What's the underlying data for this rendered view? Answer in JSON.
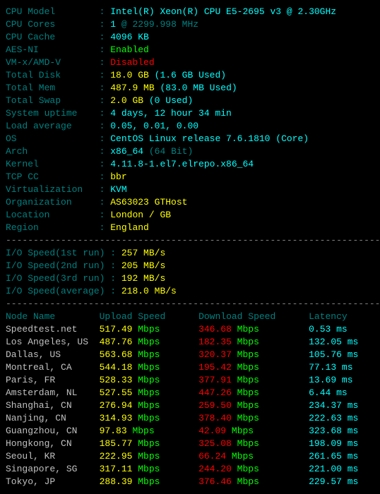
{
  "sysinfo": [
    {
      "label": "CPU Model",
      "value_main": "Intel(R) Xeon(R) CPU E5-2695 v3 @ 2.30GHz",
      "value_main_color": "aqua"
    },
    {
      "label": "CPU Cores",
      "value_main": "1",
      "value_main_color": "aqua",
      "value_sub": "@ 2299.998 MHz",
      "value_sub_color": "teal"
    },
    {
      "label": "CPU Cache",
      "value_main": "4096 KB",
      "value_main_color": "aqua"
    },
    {
      "label": "AES-NI",
      "value_main": "Enabled",
      "value_main_color": "green"
    },
    {
      "label": "VM-x/AMD-V",
      "value_main": "Disabled",
      "value_main_color": "red"
    },
    {
      "label": "Total Disk",
      "value_main": "18.0 GB",
      "value_main_color": "yellow",
      "value_sub": "(1.6 GB Used)",
      "value_sub_color": "aqua"
    },
    {
      "label": "Total Mem",
      "value_main": "487.9 MB",
      "value_main_color": "yellow",
      "value_sub": "(83.0 MB Used)",
      "value_sub_color": "aqua"
    },
    {
      "label": "Total Swap",
      "value_main": "2.0 GB",
      "value_main_color": "yellow",
      "value_sub": "(0 Used)",
      "value_sub_color": "aqua"
    },
    {
      "label": "System uptime",
      "value_main": "4 days, 12 hour 34 min",
      "value_main_color": "aqua"
    },
    {
      "label": "Load average",
      "value_main": "0.05, 0.01, 0.00",
      "value_main_color": "aqua"
    },
    {
      "label": "OS",
      "value_main": "CentOS Linux release 7.6.1810 (Core)",
      "value_main_color": "aqua"
    },
    {
      "label": "Arch",
      "value_main": "x86_64",
      "value_main_color": "aqua",
      "value_sub": "(64 Bit)",
      "value_sub_color": "teal"
    },
    {
      "label": "Kernel",
      "value_main": "4.11.8-1.el7.elrepo.x86_64",
      "value_main_color": "aqua"
    },
    {
      "label": "TCP CC",
      "value_main": "bbr",
      "value_main_color": "yellow"
    },
    {
      "label": "Virtualization",
      "value_main": "KVM",
      "value_main_color": "aqua"
    },
    {
      "label": "Organization",
      "value_main": "AS63023 GTHost",
      "value_main_color": "yellow"
    },
    {
      "label": "Location",
      "value_main": "London / GB",
      "value_main_color": "yellow"
    },
    {
      "label": "Region",
      "value_main": "England",
      "value_main_color": "yellow"
    }
  ],
  "divider": "----------------------------------------------------------------------",
  "io_label_width": 19,
  "io": [
    {
      "label": "I/O Speed(1st run)",
      "value": "257 MB/s"
    },
    {
      "label": "I/O Speed(2nd run)",
      "value": "205 MB/s"
    },
    {
      "label": "I/O Speed(3rd run)",
      "value": "192 MB/s"
    },
    {
      "label": "I/O Speed(average)",
      "value": "218.0 MB/s"
    }
  ],
  "net_header": {
    "c1": "Node Name",
    "c2": "Upload Speed",
    "c3": "Download Speed",
    "c4": "Latency"
  },
  "net_rows": [
    {
      "name": "Speedtest.net",
      "up": "517.49",
      "down": "346.68",
      "lat": "0.53 ms"
    },
    {
      "name": "Los Angeles, US",
      "up": "487.76",
      "down": "182.35",
      "lat": "132.05 ms"
    },
    {
      "name": "Dallas, US",
      "up": "563.68",
      "down": "320.37",
      "lat": "105.76 ms"
    },
    {
      "name": "Montreal, CA",
      "up": "544.18",
      "down": "195.42",
      "lat": "77.13 ms"
    },
    {
      "name": "Paris, FR",
      "up": "528.33",
      "down": "377.91",
      "lat": "13.69 ms"
    },
    {
      "name": "Amsterdam, NL",
      "up": "527.55",
      "down": "447.26",
      "lat": "6.44 ms"
    },
    {
      "name": "Shanghai, CN",
      "up": "276.94",
      "down": "259.50",
      "lat": "234.37 ms"
    },
    {
      "name": "Nanjing, CN",
      "up": "314.93",
      "down": "378.40",
      "lat": "222.63 ms"
    },
    {
      "name": "Guangzhou, CN",
      "up": "97.83",
      "down": "42.09",
      "lat": "323.68 ms"
    },
    {
      "name": "Hongkong, CN",
      "up": "185.77",
      "down": "325.08",
      "lat": "198.09 ms"
    },
    {
      "name": "Seoul, KR",
      "up": "222.95",
      "down": "66.24",
      "lat": "261.65 ms"
    },
    {
      "name": "Singapore, SG",
      "up": "317.11",
      "down": "244.20",
      "lat": "221.00 ms"
    },
    {
      "name": "Tokyo, JP",
      "up": "288.39",
      "down": "376.46",
      "lat": "229.57 ms"
    }
  ],
  "unit_mbps": "Mbps",
  "colon": ":"
}
